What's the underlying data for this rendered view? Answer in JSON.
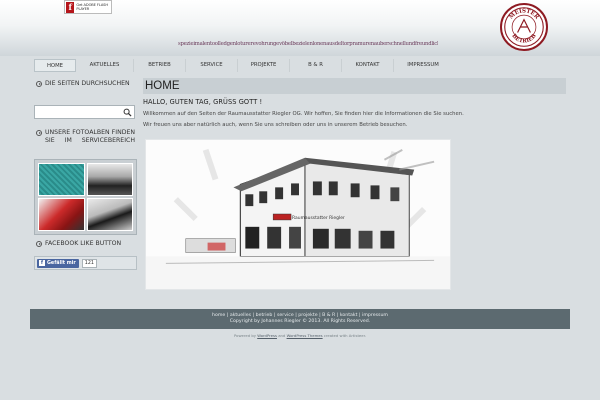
{
  "header": {
    "flash_badge_letter": "f",
    "flash_badge_text": "Get ADOBE FLASH PLAYER",
    "slogan": "spezieimalentoolledgenloturerevohrungevöbelbezielenlonenausdeltorpramurenauberschnellundfreundlich",
    "seal_text_top": "MEISTER",
    "seal_text_bottom": "BETRIEB"
  },
  "nav": {
    "items": [
      {
        "label": "HOME",
        "width": 42,
        "active": true
      },
      {
        "label": "AKTUELLES",
        "width": 58,
        "active": false
      },
      {
        "label": "BETRIEB",
        "width": 52,
        "active": false
      },
      {
        "label": "SERVICE",
        "width": 52,
        "active": false
      },
      {
        "label": "PROJEKTE",
        "width": 52,
        "active": false
      },
      {
        "label": "B & R",
        "width": 52,
        "active": false
      },
      {
        "label": "KONTAKT",
        "width": 52,
        "active": false
      },
      {
        "label": "IMPRESSUM",
        "width": 58,
        "active": false
      }
    ]
  },
  "sidebar": {
    "search_title": "DIE SEITEN DURCHSUCHEN",
    "search_placeholder": "",
    "albums_title": "UNSERE FOTOALBEN FINDEN SIE IM SERVICEBEREICH",
    "facebook_title": "FACEBOOK LIKE BUTTON",
    "fb_button_icon": "f",
    "fb_button_label": "Gefällt mir",
    "fb_count": "121"
  },
  "main": {
    "title": "HOME",
    "greeting": "HALLO, GUTEN TAG, GRÜSS GOTT !",
    "paragraph1": "Willkommen auf den Seiten der Raumausstatter Riegler OG. Wir hoffen, Sie finden hier die Informationen die Sie suchen.",
    "paragraph2": "Wir freuen uns aber natürlich auch, wenn Sie uns schreiben oder uns in unserem Betrieb besuchen.",
    "photo_sign": "Raumausstatter Riegler"
  },
  "footer": {
    "links": "home | aktuelles | betrieb | service | projekte | B & R | kontakt | impressum",
    "copyright": "Copyright by Johannes Riegler © 2013. All Rights Reserved.",
    "powered_prefix": "Powered by",
    "powered_wp": "WordPress",
    "powered_and": "and",
    "powered_themes": "WordPress Themes",
    "powered_suffix": "created with Artisteer."
  },
  "colors": {
    "accent": "#8e1a22",
    "footer_bg": "#5c6a70",
    "page_bg": "#d9dee1",
    "facebook_blue": "#4a66a0"
  },
  "icons": [
    "flash-player-icon",
    "seal-logo-icon",
    "search-icon",
    "bullet-arrow-icon",
    "facebook-icon"
  ]
}
